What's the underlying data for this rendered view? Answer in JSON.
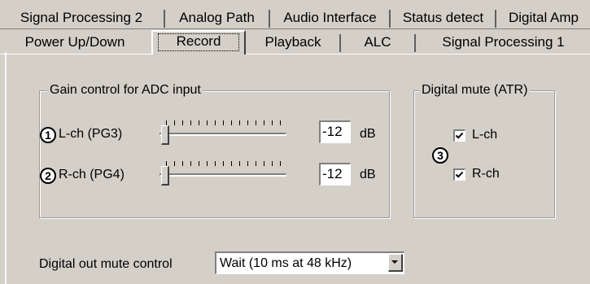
{
  "tabs_back_row": [
    {
      "label": "Signal Processing 2"
    },
    {
      "label": "Analog Path"
    },
    {
      "label": "Audio Interface"
    },
    {
      "label": "Status detect"
    },
    {
      "label": "Digital Amp"
    }
  ],
  "tabs_front_row": [
    {
      "label": "Power Up/Down"
    },
    {
      "label": "Record",
      "selected": true
    },
    {
      "label": "Playback"
    },
    {
      "label": "ALC"
    },
    {
      "label": "Signal Processing 1"
    }
  ],
  "gain_group": {
    "title": "Gain control for ADC input",
    "channels": [
      {
        "marker": "1",
        "label": "L-ch  (PG3)",
        "value": "-12",
        "unit": "dB",
        "slider_position": 0
      },
      {
        "marker": "2",
        "label": "R-ch  (PG4)",
        "value": "-12",
        "unit": "dB",
        "slider_position": 0
      }
    ]
  },
  "mute_group": {
    "title": "Digital mute (ATR)",
    "marker": "3",
    "items": [
      {
        "label": "L-ch",
        "checked": true
      },
      {
        "label": "R-ch",
        "checked": true
      }
    ]
  },
  "digital_out": {
    "label": "Digital out mute control",
    "selected": "Wait (10 ms at 48 kHz)"
  }
}
